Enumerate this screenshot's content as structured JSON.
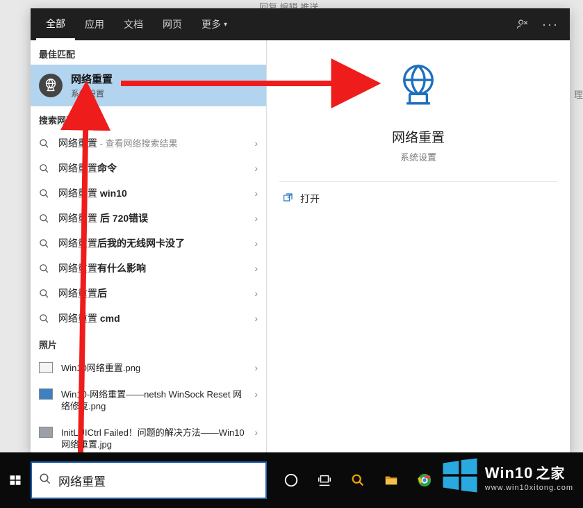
{
  "bg": {
    "top_links": "回复  编辑  推送",
    "right_cut": "理"
  },
  "tabs": {
    "all": "全部",
    "apps": "应用",
    "docs": "文档",
    "web": "网页",
    "more": "更多"
  },
  "sections": {
    "best_match": "最佳匹配",
    "search_web": "搜索网页",
    "photos": "照片"
  },
  "best_match": {
    "title": "网络重置",
    "subtitle": "系统设置"
  },
  "web_results": [
    {
      "base": "网络重置",
      "bold": "",
      "suffix": " - 查看网络搜索结果"
    },
    {
      "base": "网络重置",
      "bold": "命令",
      "suffix": ""
    },
    {
      "base": "网络重置 ",
      "bold": "win10",
      "suffix": ""
    },
    {
      "base": "网络重置 ",
      "bold": "后 720错误",
      "suffix": ""
    },
    {
      "base": "网络重置",
      "bold": "后我的无线网卡没了",
      "suffix": ""
    },
    {
      "base": "网络重置",
      "bold": "有什么影响",
      "suffix": ""
    },
    {
      "base": "网络重置",
      "bold": "后",
      "suffix": ""
    },
    {
      "base": "网络重置 ",
      "bold": "cmd",
      "suffix": ""
    }
  ],
  "photos": [
    {
      "name": "Win10网络重置.png",
      "thumb": "white"
    },
    {
      "name": "Win10-网络重置——netsh WinSock Reset 网络修复.png",
      "thumb": "blue"
    },
    {
      "name": "InitLUICtrl Failed！问题的解决方法——Win10网络重置.jpg",
      "thumb": "gray"
    }
  ],
  "detail": {
    "title": "网络重置",
    "subtitle": "系统设置",
    "open_label": "打开"
  },
  "search": {
    "value": "网络重置"
  },
  "brand": {
    "name": "Win10",
    "suffix": "之家",
    "url": "www.win10xitong.com"
  }
}
